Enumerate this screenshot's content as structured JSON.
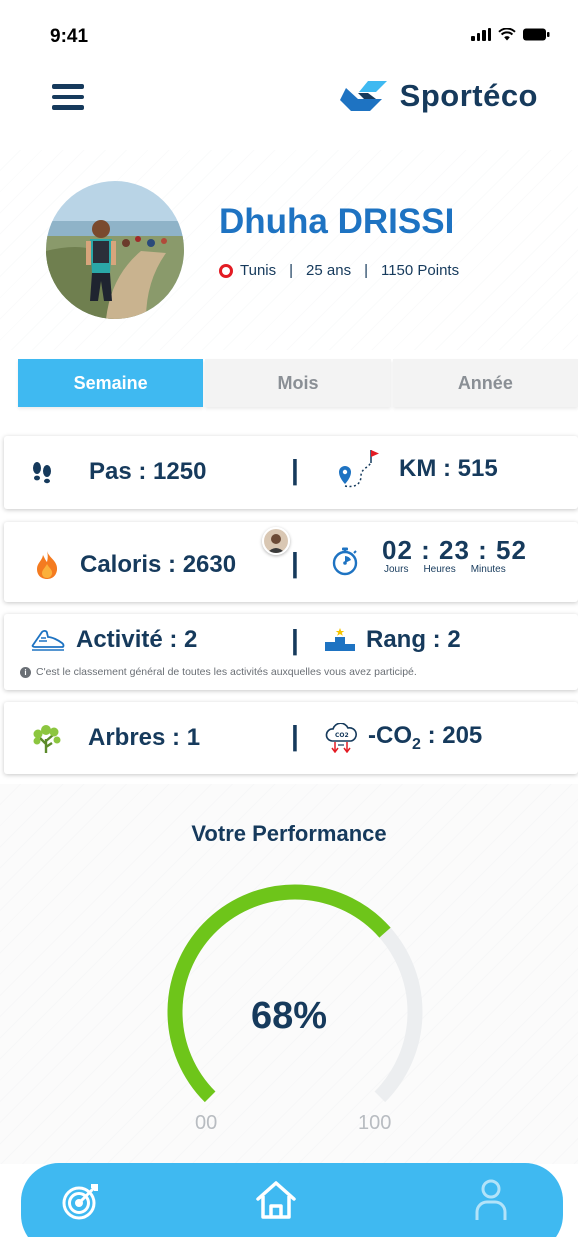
{
  "status_bar": {
    "time": "9:41"
  },
  "header": {
    "logo_text": "Sportéco"
  },
  "profile": {
    "name": "Dhuha DRISSI",
    "city": "Tunis",
    "age": "25 ans",
    "points": "1150 Points",
    "separator": "|"
  },
  "tabs": [
    {
      "label": "Semaine",
      "active": true
    },
    {
      "label": "Mois",
      "active": false
    },
    {
      "label": "Année",
      "active": false
    }
  ],
  "stats": {
    "steps": "Pas : 1250",
    "km": "KM : 515",
    "calories": "Caloris : 2630",
    "timer": {
      "value": "02 : 23 : 52",
      "units": [
        "Jours",
        "Heures",
        "Minutes"
      ]
    },
    "activity": "Activité : 2",
    "rank": "Rang : 2",
    "rank_note": "C'est le classement général de toutes les activités auxquelles vous avez participé.",
    "trees": "Arbres : 1",
    "co2": {
      "prefix": "-CO",
      "subscript": "2",
      "suffix": " : 205"
    },
    "separator": "|"
  },
  "performance": {
    "title": "Votre Performance",
    "value_label": "68%",
    "value": 68,
    "min_label": "00",
    "max_label": "100"
  },
  "colors": {
    "brand_dark": "#163a5c",
    "brand_blue": "#1e73c2",
    "accent": "#3fb9f1",
    "gauge_fill": "#6ec51a",
    "gauge_track": "#eceef0"
  },
  "bottom_nav": {
    "icons": [
      "target-icon",
      "home-icon",
      "user-icon"
    ]
  }
}
